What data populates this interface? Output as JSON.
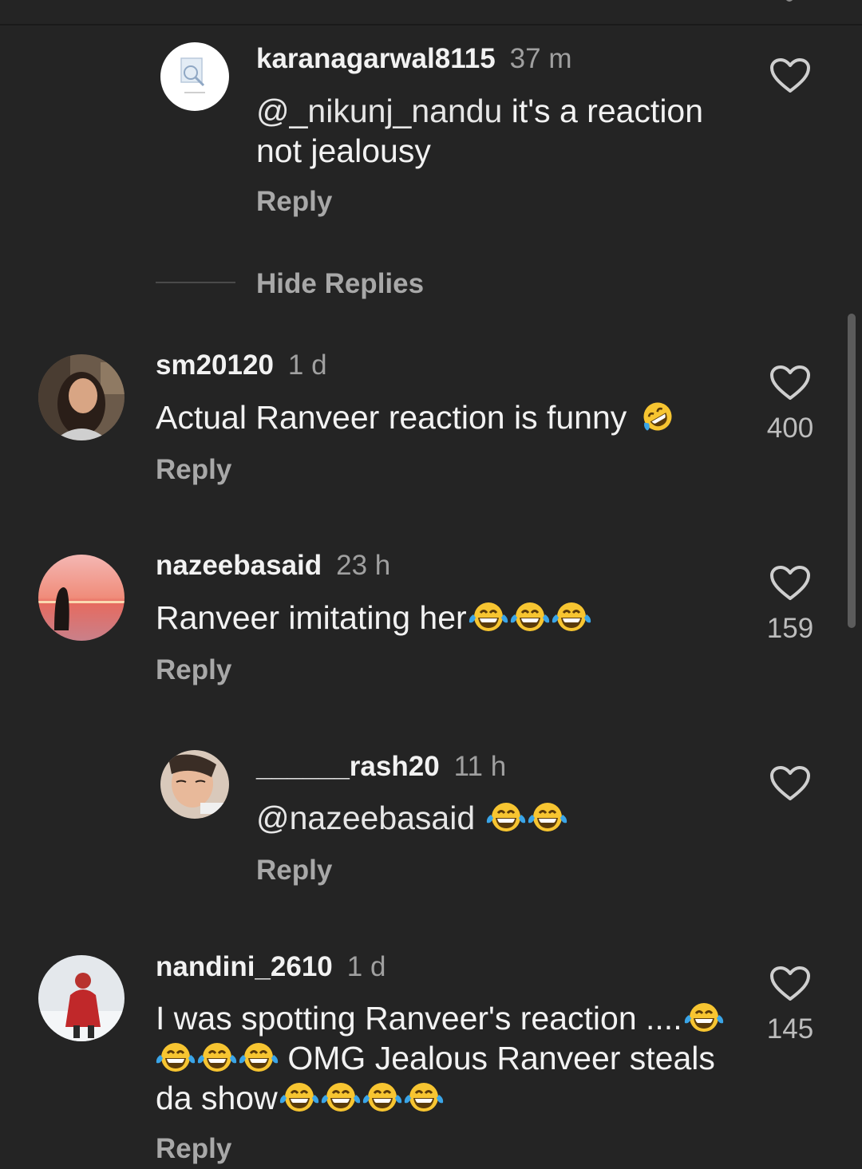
{
  "comments": [
    {
      "username": "karanagarwal8115",
      "time": "37 m",
      "mention": "@_nikunj_nandu",
      "text_line1_rest": " it's a reaction",
      "text_line2": "not jealousy",
      "reply_label": "Reply"
    },
    {
      "username": "sm20120",
      "time": "1 d",
      "text": "Actual Ranveer reaction is funny",
      "likes": "400",
      "reply_label": "Reply"
    },
    {
      "username": "nazeebasaid",
      "time": "23 h",
      "text": "Ranveer imitating her",
      "likes": "159",
      "reply_label": "Reply"
    },
    {
      "username": "______rash20",
      "time": "11 h",
      "mention": "@nazeebasaid",
      "reply_label": "Reply"
    },
    {
      "username": "nandini_2610",
      "time": "1 d",
      "text_line1": "I was spotting Ranveer's reaction ....",
      "text_line2": " OMG Jealous Ranveer steals",
      "text_line3": "da show",
      "likes": "145",
      "reply_label": "Reply"
    }
  ],
  "hide_replies_label": "Hide Replies",
  "icons": {
    "like": "heart-outline-icon",
    "emoji_laugh": "face-with-tears-of-joy",
    "emoji_rofl": "rolling-on-the-floor-laughing"
  },
  "colors": {
    "background": "#242424",
    "text": "#f2f2f2",
    "muted": "#a8a8a8",
    "emoji_yellow": "#f7c531"
  }
}
